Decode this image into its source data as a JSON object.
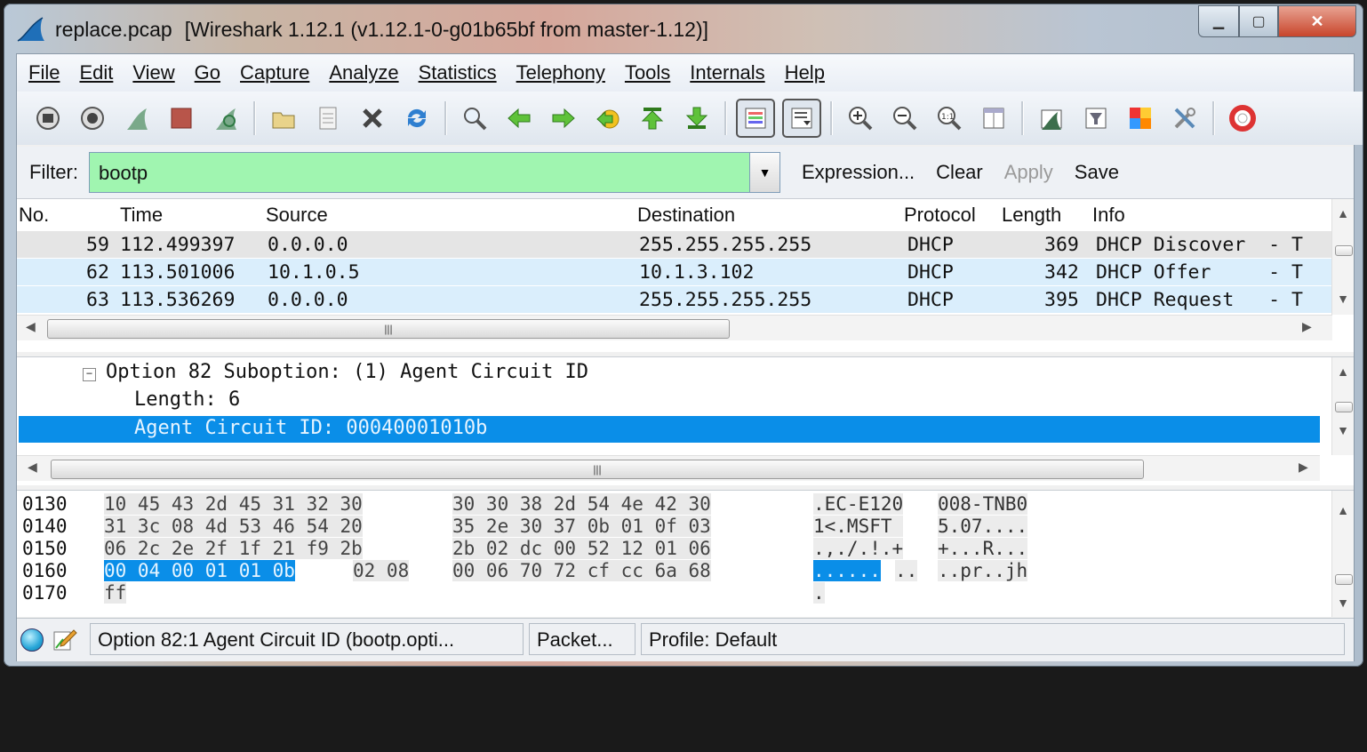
{
  "window": {
    "title_file": "replace.pcap",
    "title_app": "[Wireshark 1.12.1  (v1.12.1-0-g01b65bf from master-1.12)]"
  },
  "menu": [
    "File",
    "Edit",
    "View",
    "Go",
    "Capture",
    "Analyze",
    "Statistics",
    "Telephony",
    "Tools",
    "Internals",
    "Help"
  ],
  "toolbar_icons": [
    "interface-list-icon",
    "capture-options-icon",
    "start-capture-icon",
    "stop-capture-icon",
    "restart-capture-icon",
    "open-file-icon",
    "save-file-icon",
    "close-file-icon",
    "reload-icon",
    "find-packet-icon",
    "go-back-icon",
    "go-forward-icon",
    "go-to-packet-icon",
    "go-first-icon",
    "go-last-icon",
    "colorize-icon",
    "auto-scroll-icon",
    "zoom-in-icon",
    "zoom-out-icon",
    "normal-size-icon",
    "resize-columns-icon",
    "capture-filters-icon",
    "display-filters-icon",
    "coloring-rules-icon",
    "preferences-icon",
    "help-icon"
  ],
  "filter": {
    "label": "Filter:",
    "value": "bootp",
    "expression": "Expression...",
    "clear": "Clear",
    "apply": "Apply",
    "save": "Save",
    "valid_color": "#a0f5b0"
  },
  "packet_list": {
    "columns": [
      "No.",
      "Time",
      "Source",
      "Destination",
      "Protocol",
      "Length",
      "Info"
    ],
    "rows": [
      {
        "no": "59",
        "time": "112.499397",
        "source": "0.0.0.0",
        "destination": "255.255.255.255",
        "protocol": "DHCP",
        "length": "369",
        "info": "DHCP Discover  - T"
      },
      {
        "no": "62",
        "time": "113.501006",
        "source": "10.1.0.5",
        "destination": "10.1.3.102",
        "protocol": "DHCP",
        "length": "342",
        "info": "DHCP Offer     - T"
      },
      {
        "no": "63",
        "time": "113.536269",
        "source": "0.0.0.0",
        "destination": "255.255.255.255",
        "protocol": "DHCP",
        "length": "395",
        "info": "DHCP Request   - T"
      }
    ]
  },
  "details": {
    "lines": [
      "Option 82 Suboption: (1) Agent Circuit ID",
      "Length: 6",
      "Agent Circuit ID: 00040001010b"
    ]
  },
  "bytes": {
    "rows": [
      {
        "offset": "0130",
        "hex1": "10 45 43 2d 45 31 32 30",
        "hex2": "30 30 38 2d 54 4e 42 30",
        "ascii1": ".EC-E120",
        "ascii2": "008-TNB0"
      },
      {
        "offset": "0140",
        "hex1": "31 3c 08 4d 53 46 54 20",
        "hex2": "35 2e 30 37 0b 01 0f 03",
        "ascii1": "1<.MSFT ",
        "ascii2": "5.07...."
      },
      {
        "offset": "0150",
        "hex1": "06 2c 2e 2f 1f 21 f9 2b",
        "hex2": "2b 02 dc 00 52 12 01 06",
        "ascii1": ".,./.!.+",
        "ascii2": "+...R..."
      },
      {
        "offset": "0160",
        "hex1_sel": "00 04 00 01 01 0b",
        "hex1_rest": "02 08",
        "hex2": "00 06 70 72 cf cc 6a 68",
        "ascii1_sel": "......",
        "ascii1_rest": "..",
        "ascii2": "..pr..jh"
      },
      {
        "offset": "0170",
        "hex1": "ff",
        "ascii1": "."
      }
    ]
  },
  "status": {
    "field": "Option 82:1 Agent Circuit ID (bootp.opti...",
    "packets": "Packet...",
    "profile": "Profile: Default"
  },
  "colors": {
    "selection": "#0a8ee8",
    "row_highlight": "#daeefc",
    "row_grey": "#e5e5e5"
  }
}
